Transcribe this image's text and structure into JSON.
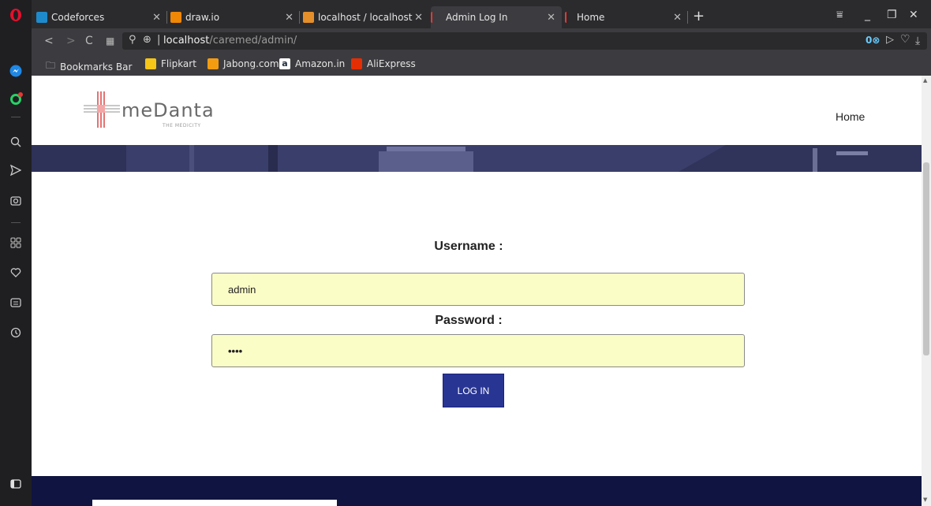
{
  "browser": {
    "tabs": [
      {
        "label": "Codeforces",
        "favicon_color": "#1f8acb"
      },
      {
        "label": "draw.io",
        "favicon_color": "#f08705"
      },
      {
        "label": "localhost / localhost /",
        "favicon_color": "#e48f2a"
      },
      {
        "label": "Admin Log In",
        "favicon_color": "#e53935"
      },
      {
        "label": "Home",
        "favicon_color": "#e53935"
      }
    ],
    "new_tab_symbol": "+",
    "window_controls": [
      "⩸",
      "_",
      "❐",
      "✕"
    ],
    "url_host": "localhost",
    "url_path": "/caremed/admin/",
    "bookmarks": [
      {
        "label": "Bookmarks Bar",
        "icon": "folder-icon"
      },
      {
        "label": "Flipkart",
        "favicon_color": "#f5c518"
      },
      {
        "label": "Jabong.com",
        "favicon_color": "#f39c12"
      },
      {
        "label": "Amazon.in",
        "favicon_color": "#232f3e"
      },
      {
        "label": "AliExpress",
        "favicon_color": "#e62e04"
      }
    ]
  },
  "sidebar_icons": [
    "opera-logo-icon",
    "messenger-icon",
    "whatsapp-icon",
    "search-icon",
    "send-icon",
    "camera-icon",
    "speed-dial-icon",
    "heart-icon",
    "news-icon",
    "history-icon",
    "sidebar-toggle-icon"
  ],
  "site": {
    "brand": "meDanta",
    "tagline": "THE MEDICITY",
    "nav_home": "Home"
  },
  "form": {
    "username_label": "Username :",
    "username_value": "admin",
    "password_label": "Password :",
    "password_value": "••••",
    "submit_label": "LOG IN"
  },
  "colors": {
    "accent": "#283593",
    "input_bg": "#fbfdc7",
    "banner": "#3a3e6a",
    "footer": "#0f1440"
  }
}
